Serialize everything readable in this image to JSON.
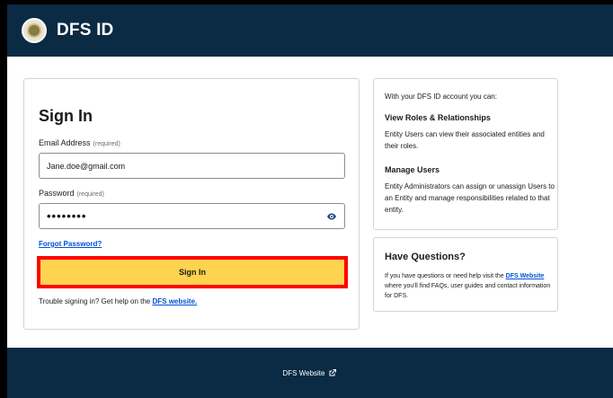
{
  "header": {
    "brand": "DFS ID",
    "seal_icon": "state-seal-icon"
  },
  "signin": {
    "title": "Sign In",
    "email_label": "Email Address",
    "email_required": "(required)",
    "email_value": "Jane.doe@gmail.com",
    "password_label": "Password",
    "password_required": "(required)",
    "password_value": "••••••••",
    "show_password_icon": "eye-icon",
    "forgot_link": "Forgot Password?",
    "submit_label": "Sign In",
    "trouble_text": "Trouble signing in? Get help on the",
    "trouble_link": "DFS website."
  },
  "info": {
    "intro": "With your DFS ID account you can:",
    "sections": [
      {
        "heading": "View Roles & Relationships",
        "body": "Entity Users can view their associated entities and their roles."
      },
      {
        "heading": "Manage Users",
        "body": "Entity Administrators can assign or unassign Users to an Entity and manage responsibilities related to that entity."
      }
    ]
  },
  "questions": {
    "title": "Have Questions?",
    "text_before": "If you have questions or need help visit the",
    "link": "DFS Website",
    "text_after": "where you'll find FAQs, user guides and contact information for DFS."
  },
  "footer": {
    "link": "DFS Website",
    "icon": "external-link-icon"
  },
  "colors": {
    "navy": "#0b2a44",
    "button_yellow": "#fdd34f",
    "link_blue": "#0050d8",
    "highlight_red": "#ff0000"
  }
}
